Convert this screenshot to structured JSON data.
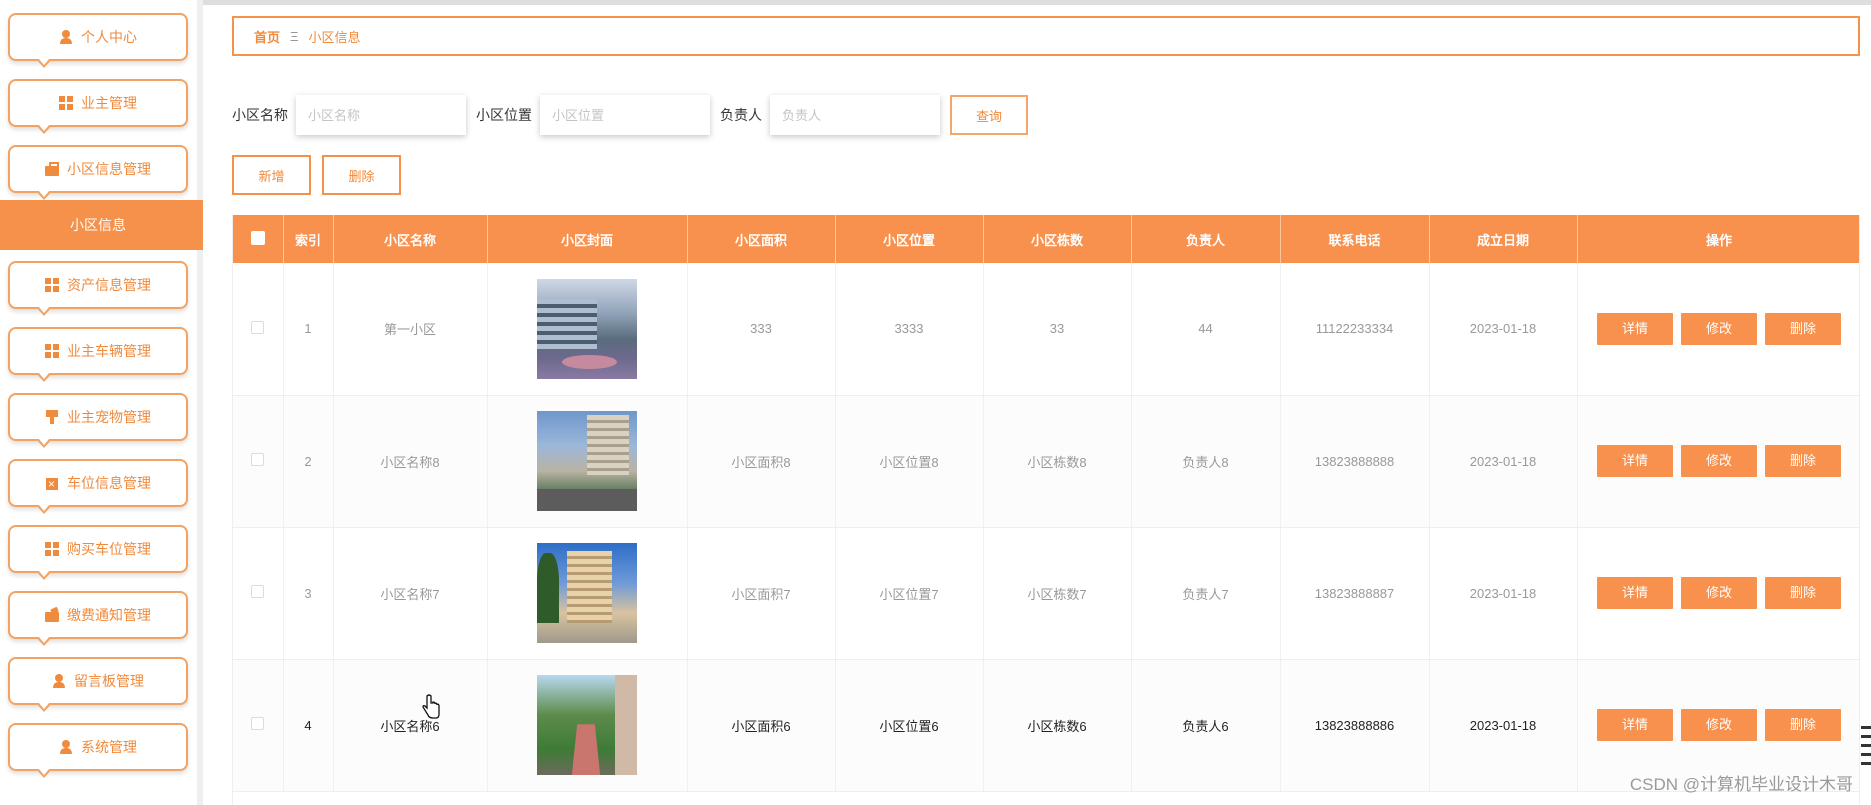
{
  "sidebar": {
    "items": [
      {
        "label": "个人中心",
        "icon": "user-icon"
      },
      {
        "label": "业主管理",
        "icon": "grid-icon"
      },
      {
        "label": "小区信息管理",
        "icon": "briefcase-icon"
      },
      {
        "label": "资产信息管理",
        "icon": "grid-icon"
      },
      {
        "label": "业主车辆管理",
        "icon": "grid-icon"
      },
      {
        "label": "业主宠物管理",
        "icon": "brush-icon"
      },
      {
        "label": "车位信息管理",
        "icon": "clipboard-icon"
      },
      {
        "label": "购买车位管理",
        "icon": "grid-icon"
      },
      {
        "label": "缴费通知管理",
        "icon": "wallet-icon"
      },
      {
        "label": "留言板管理",
        "icon": "user-icon"
      },
      {
        "label": "系统管理",
        "icon": "user-icon"
      }
    ],
    "active_sub": "小区信息"
  },
  "breadcrumb": {
    "home": "首页",
    "separator": "Ξ",
    "current": "小区信息"
  },
  "search": {
    "name_label": "小区名称",
    "name_placeholder": "小区名称",
    "location_label": "小区位置",
    "location_placeholder": "小区位置",
    "manager_label": "负责人",
    "manager_placeholder": "负责人",
    "query_label": "查询"
  },
  "actions": {
    "add_label": "新增",
    "delete_label": "删除"
  },
  "table": {
    "headers": [
      "索引",
      "小区名称",
      "小区封面",
      "小区面积",
      "小区位置",
      "小区栋数",
      "负责人",
      "联系电话",
      "成立日期",
      "操作"
    ],
    "rows": [
      {
        "index": "1",
        "name": "第一小区",
        "area": "333",
        "location": "3333",
        "buildings": "33",
        "manager": "44",
        "phone": "11122233334",
        "date": "2023-01-18"
      },
      {
        "index": "2",
        "name": "小区名称8",
        "area": "小区面积8",
        "location": "小区位置8",
        "buildings": "小区栋数8",
        "manager": "负责人8",
        "phone": "13823888888",
        "date": "2023-01-18"
      },
      {
        "index": "3",
        "name": "小区名称7",
        "area": "小区面积7",
        "location": "小区位置7",
        "buildings": "小区栋数7",
        "manager": "负责人7",
        "phone": "13823888887",
        "date": "2023-01-18"
      },
      {
        "index": "4",
        "name": "小区名称6",
        "area": "小区面积6",
        "location": "小区位置6",
        "buildings": "小区栋数6",
        "manager": "负责人6",
        "phone": "13823888886",
        "date": "2023-01-18"
      }
    ],
    "op_detail": "详情",
    "op_edit": "修改",
    "op_delete": "删除"
  },
  "watermark": "CSDN @计算机毕业设计木哥",
  "colors": {
    "accent": "#f7914d",
    "accent_text": "#f08a3c"
  }
}
